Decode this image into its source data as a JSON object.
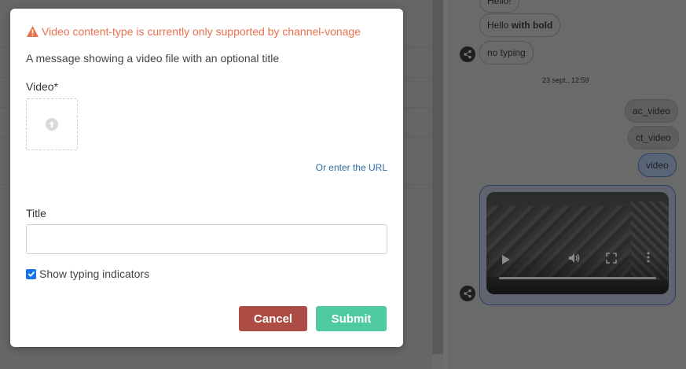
{
  "modal": {
    "warning": "Video content-type is currently only supported by channel-vonage",
    "description": "A message showing a video file with an optional title",
    "video_label": "Video*",
    "url_link": "Or enter the URL",
    "title_label": "Title",
    "title_value": "",
    "title_placeholder": "",
    "show_typing_label": "Show typing indicators",
    "show_typing_checked": true,
    "cancel_label": "Cancel",
    "submit_label": "Submit"
  },
  "chat": {
    "partial_top": "Hello!",
    "messages": [
      {
        "prefix": "Hello ",
        "bold": "with bold"
      },
      {
        "text": "no typing"
      }
    ],
    "timestamp": "23 sept., 12:59",
    "sent": [
      "ac_video",
      "ct_video",
      "video"
    ]
  },
  "colors": {
    "warning": "#e8704d",
    "cancel": "#ad4b45",
    "submit": "#4fc9a0",
    "link": "#2e6da4",
    "checkbox": "#1a73e8"
  }
}
